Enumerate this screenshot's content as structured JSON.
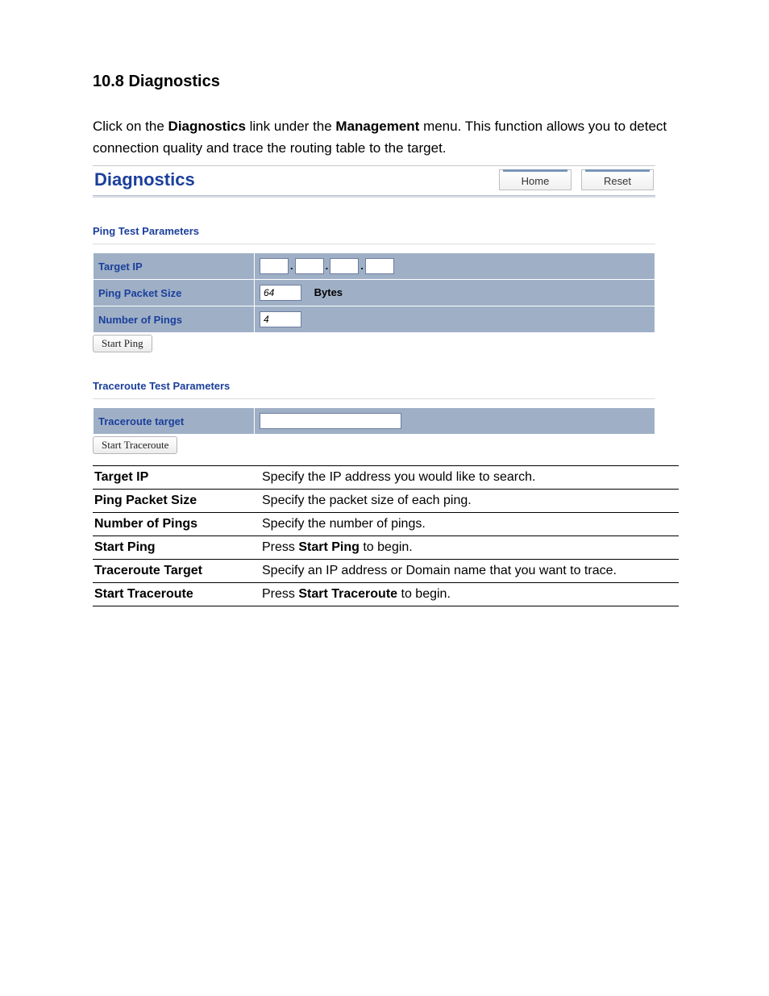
{
  "heading": "10.8 Diagnostics",
  "intro": {
    "pre1": "Click on the ",
    "b1": "Diagnostics",
    "mid1": " link under the ",
    "b2": "Management",
    "post1": " menu. This function allows you to detect connection quality and trace the routing table to the target."
  },
  "app": {
    "title": "Diagnostics",
    "buttons": {
      "home": "Home",
      "reset": "Reset"
    },
    "ping": {
      "section": "Ping Test Parameters",
      "target_ip_label": "Target IP",
      "target_ip": {
        "o1": "",
        "o2": "",
        "o3": "",
        "o4": ""
      },
      "packet_size_label": "Ping Packet Size",
      "packet_size_value": "64",
      "packet_size_unit": "Bytes",
      "num_pings_label": "Number of Pings",
      "num_pings_value": "4",
      "start_btn": "Start Ping"
    },
    "trace": {
      "section": "Traceroute Test Parameters",
      "target_label": "Traceroute target",
      "target_value": "",
      "start_btn": "Start Traceroute"
    }
  },
  "desc": {
    "rows": [
      {
        "label": "Target IP",
        "pre": "Specify the IP address you would like to search.",
        "bold": "",
        "post": ""
      },
      {
        "label": "Ping Packet Size",
        "pre": "Specify the packet size of each ping.",
        "bold": "",
        "post": ""
      },
      {
        "label": "Number of Pings",
        "pre": "Specify the number of pings.",
        "bold": "",
        "post": ""
      },
      {
        "label": "Start Ping",
        "pre": "Press ",
        "bold": "Start Ping",
        "post": " to begin."
      },
      {
        "label": "Traceroute Target",
        "pre": "Specify an IP address or Domain name that you want to trace.",
        "bold": "",
        "post": ""
      },
      {
        "label": "Start Traceroute",
        "pre": "Press ",
        "bold": "Start Traceroute",
        "post": " to begin."
      }
    ]
  }
}
